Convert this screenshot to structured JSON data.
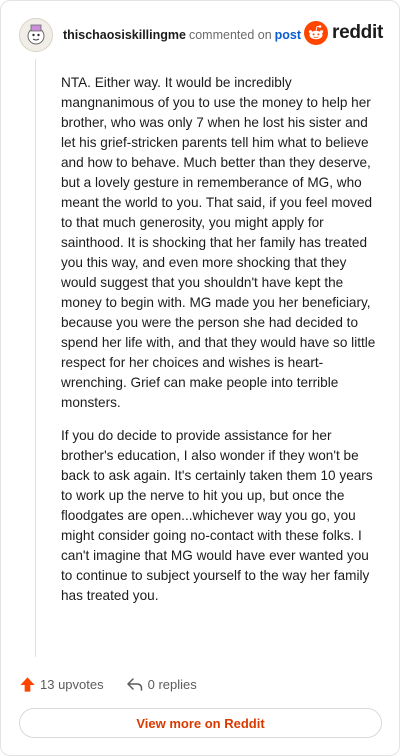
{
  "header": {
    "username": "thischaosiskillingme",
    "commented_text": "commented on",
    "post_link": "post",
    "brand": "reddit"
  },
  "comment": {
    "paragraphs": [
      "NTA. Either way. It would be incredibly mangnanimous of you to use the money to help her brother, who was only 7 when he lost his sister and let his grief-stricken parents tell him what to believe and how to behave. Much better than they deserve, but a lovely gesture in rememberance of MG, who meant the world to you. That said, if you feel moved to that much generosity, you might apply for sainthood. It is shocking that her family has treated you this way, and even more shocking that they would suggest that you shouldn't have kept the money to begin with. MG made you her beneficiary, because you were the person she had decided to spend her life with, and that they would have so little respect for her choices and wishes is heart-wrenching. Grief can make people into terrible monsters.",
      "If you do decide to provide assistance for her brother's education, I also wonder if they won't be back to ask again. It's certainly taken them 10 years to work up the nerve to hit you up, but once the floodgates are open...whichever way you go, you might consider going no-contact with these folks. I can't imagine that MG would have ever wanted you to continue to subject yourself to the way her family has treated you."
    ]
  },
  "footer": {
    "upvotes": "13 upvotes",
    "replies": "0 replies",
    "view_more": "View more on Reddit"
  },
  "colors": {
    "brand_orange": "#ff4500",
    "link_blue": "#0b5bd3",
    "view_more_text": "#d93a00"
  },
  "icons": {
    "avatar": "user-avatar-icon",
    "logo": "reddit-snoo-icon",
    "upvote": "upvote-arrow-icon",
    "reply": "reply-arrow-icon"
  }
}
